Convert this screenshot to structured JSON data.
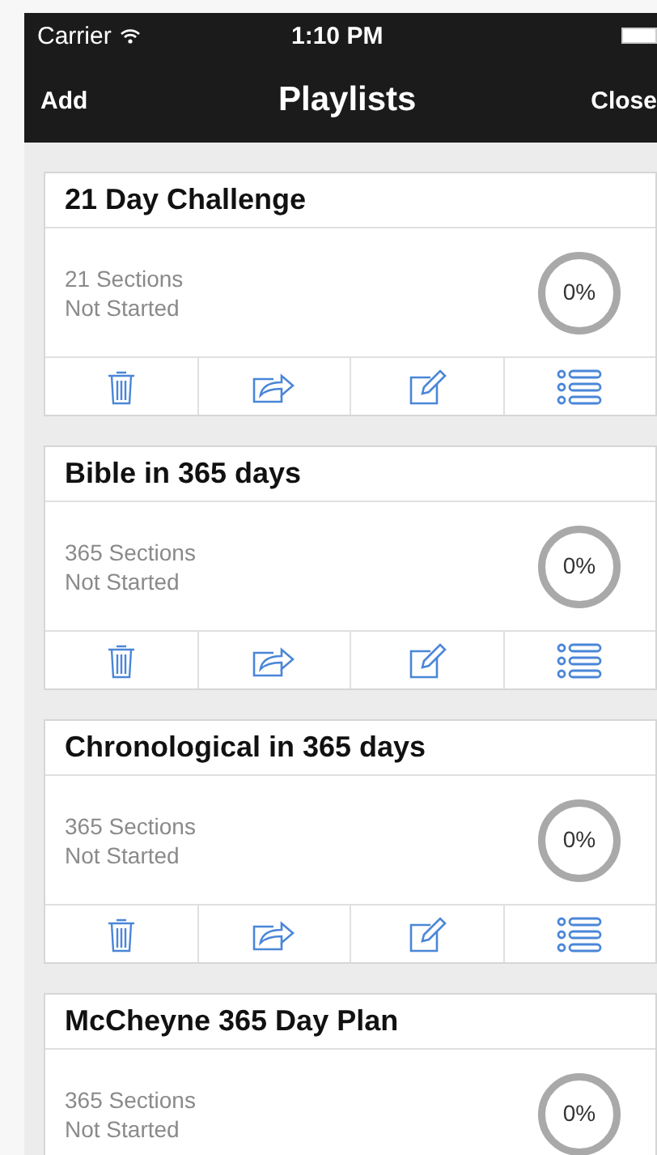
{
  "status_bar": {
    "carrier": "Carrier",
    "time": "1:10 PM"
  },
  "nav_bar": {
    "left_button": "Add",
    "title": "Playlists",
    "right_button": "Close"
  },
  "playlists": [
    {
      "title": "21 Day Challenge",
      "sections": "21 Sections",
      "status": "Not Started",
      "percent": "0%",
      "level": 0
    },
    {
      "title": "Bible in 365 days",
      "sections": "365 Sections",
      "status": "Not Started",
      "percent": "0%",
      "level": 0
    },
    {
      "title": "Chronological in 365 days",
      "sections": "365 Sections",
      "status": "Not Started",
      "percent": "0%",
      "level": 0
    },
    {
      "title": "McCheyne 365 Day Plan",
      "sections": "365 Sections",
      "status": "Not Started",
      "percent": "0%",
      "level": 0
    }
  ]
}
